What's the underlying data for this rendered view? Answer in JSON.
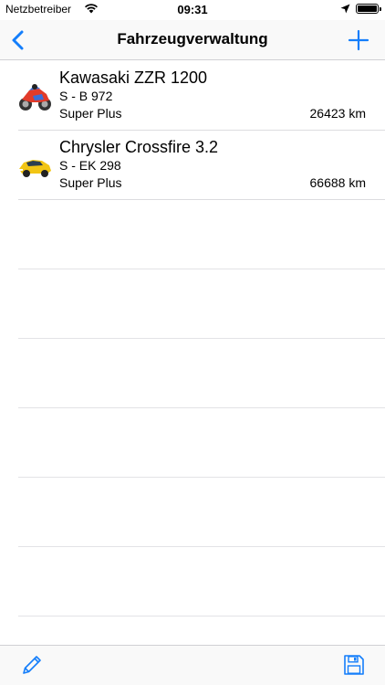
{
  "status_bar": {
    "carrier": "Netzbetreiber",
    "time": "09:31",
    "battery_level": 1.0
  },
  "nav_bar": {
    "title": "Fahrzeugverwaltung",
    "back_icon": "chevron-left-icon",
    "add_icon": "plus-icon",
    "accent_color": "#147efb"
  },
  "vehicles": [
    {
      "name": "Kawasaki ZZR 1200",
      "plate": "S - B 972",
      "fuel": "Super Plus",
      "mileage": "26423 km",
      "icon": "motorcycle-icon"
    },
    {
      "name": "Chrysler Crossfire 3.2",
      "plate": "S - EK 298",
      "fuel": "Super Plus",
      "mileage": "66688 km",
      "icon": "car-icon"
    }
  ],
  "toolbar": {
    "edit_icon": "pencil-icon",
    "save_icon": "floppy-disk-icon"
  }
}
